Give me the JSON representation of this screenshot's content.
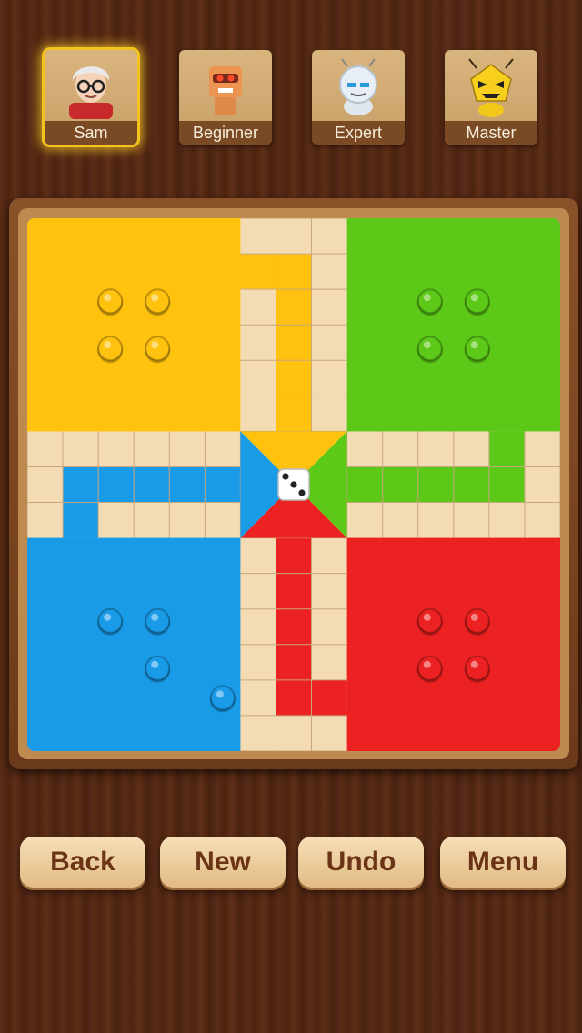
{
  "players": [
    {
      "name": "Sam",
      "active": true,
      "avatar": "sam-avatar-icon"
    },
    {
      "name": "Beginner",
      "active": false,
      "avatar": "robot-avatar-icon"
    },
    {
      "name": "Expert",
      "active": false,
      "avatar": "silver-robot-avatar-icon"
    },
    {
      "name": "Master",
      "active": false,
      "avatar": "yellow-bot-avatar-icon"
    }
  ],
  "colors": {
    "yellow": "#ffc20e",
    "green": "#5cc817",
    "blue": "#1a9be8",
    "red": "#ec2121",
    "wood": "#f3dcb3"
  },
  "dice": {
    "value": 3
  },
  "tokens": {
    "yellow": {
      "home_count": 4
    },
    "green": {
      "home_count": 4
    },
    "blue": {
      "home_count": 3,
      "on_board": 1
    },
    "red": {
      "home_count": 4
    }
  },
  "buttons": {
    "back": "Back",
    "new": "New",
    "undo": "Undo",
    "menu": "Menu"
  }
}
